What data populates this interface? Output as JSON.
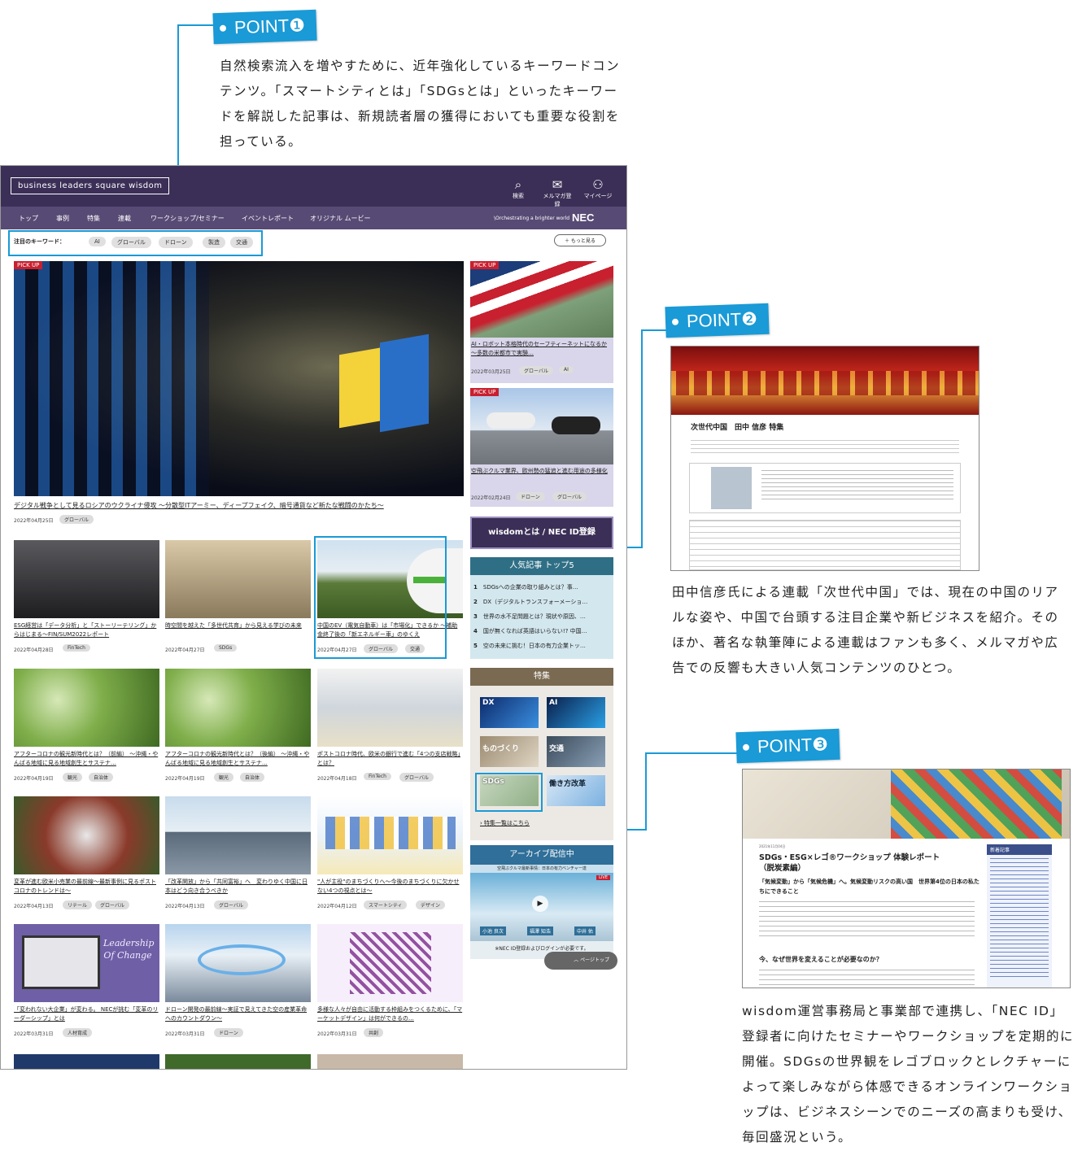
{
  "points": [
    {
      "label": "POINT❶",
      "text": "自然検索流入を増やすために、近年強化しているキーワードコンテンツ。「スマートシティとは」「SDGsとは」といったキーワードを解説した記事は、新規読者層の獲得においても重要な役割を担っている。"
    },
    {
      "label": "POINT❷",
      "text": "田中信彦氏による連載「次世代中国」では、現在の中国のリアルな姿や、中国で台頭する注目企業や新ビジネスを紹介。そのほか、著名な執筆陣による連載はファンも多く、メルマガや広告での反響も大きい人気コンテンツのひとつ。"
    },
    {
      "label": "POINT❸",
      "text": "wisdom運営事務局と事業部で連携し、「NEC ID」登録者に向けたセミナーやワークショップを定期的に開催。SDGsの世界観をレゴブロックとレクチャーによって楽しみながら体感できるオンラインワークショップは、ビジネスシーンでのニーズの高まりも受け、毎回盛況という。"
    }
  ],
  "site": {
    "logo": "business leaders square wisdom",
    "header_icons": [
      {
        "icon": "search-icon",
        "label": "検索"
      },
      {
        "icon": "mail-icon",
        "label": "メルマガ登録"
      },
      {
        "icon": "user-icon",
        "label": "マイページ"
      }
    ],
    "nav": [
      "トップ",
      "事例",
      "特集",
      "連載",
      "ワークショップ/セミナー",
      "イベントレポート",
      "オリジナル ムービー"
    ],
    "tagline": "\\Orchestrating a brighter world",
    "brand": "NEC",
    "keyword_label": "注目のキーワード：",
    "keywords": [
      "AI",
      "グローバル",
      "ドローン",
      "製造",
      "交通"
    ],
    "more": "もっと見る",
    "pickup": "PICK UP",
    "hero": {
      "title": "デジタル戦争として見るロシアのウクライナ侵攻 ～分散型ITアーミー、ディープフェイク、暗号通貨など新たな戦闘のかたち～",
      "date": "2022年04月25日",
      "tags": [
        "グローバル"
      ]
    },
    "side_articles": [
      {
        "title": "AI・ロボット本格時代のセーフティーネットになるか ～多数の米都市で実験…",
        "date": "2022年03月25日",
        "tags": [
          "グローバル",
          "AI"
        ]
      },
      {
        "title": "空飛ぶクルマ業界、欧州勢の猛追と進む用途の多様化",
        "date": "2022年02月24日",
        "tags": [
          "ドローン",
          "グローバル"
        ]
      }
    ],
    "wisdom_button": "wisdomとは / NEC ID登録",
    "ranking": {
      "title": "人気記事 トップ5",
      "items": [
        "SDGsへの企業の取り組みとは？事…",
        "DX（デジタルトランスフォーメーショ…",
        "世界の水不足問題とは？現状や原因、…",
        "国が無くなれば英語はいらない!? 中国…",
        "空の未来に挑む！日本の有力企業トッ…"
      ]
    },
    "feature": {
      "title": "特集",
      "items": [
        "DX",
        "AI",
        "ものづくり",
        "交通",
        "SDGs",
        "働き方改革"
      ],
      "link": "特集一覧はこちら"
    },
    "archive": {
      "title": "アーカイブ配信中",
      "subtitle": "空飛ぶクルマ最新事情：日本の有力ベンチャー達",
      "live": "LIVE",
      "names": [
        "小池 良次",
        "福澤 知浩",
        "中井 佑"
      ],
      "note": "※NEC ID登録およびログインが必要です。"
    },
    "page_top": "ページトップ",
    "articles": [
      {
        "title": "ESG経営は「データ分析」と「ストーリーテリング」からはじまる～FIN/SUM2022レポート",
        "date": "2022年04月28日",
        "tags": [
          "FinTech"
        ]
      },
      {
        "title": "時空間を越えた「多世代共育」から見える学びの未来",
        "date": "2022年04月27日",
        "tags": [
          "SDGs"
        ]
      },
      {
        "title": "中国のEV（電気自動車）は「市場化」できるか ～補助金終了後の「新エネルギー車」のゆくえ",
        "date": "2022年04月27日",
        "tags": [
          "グローバル",
          "交通"
        ]
      },
      {
        "title": "アフターコロナの観光新時代とは？（前編） ～沖縄・やんばる地域に見る地域創生とサステナ…",
        "date": "2022年04月19日",
        "tags": [
          "観光",
          "自治体"
        ]
      },
      {
        "title": "アフターコロナの観光新時代とは？（後編） ～沖縄・やんばる地域に見る地域創生とサステナ…",
        "date": "2022年04月19日",
        "tags": [
          "観光",
          "自治体"
        ]
      },
      {
        "title": "ポストコロナ時代、欧米の銀行で進む「4つの支店戦略」とは？",
        "date": "2022年04月18日",
        "tags": [
          "FinTech",
          "グローバル"
        ]
      },
      {
        "title": "変革が進む欧米小売業の最前線～最新事例に見るポストコロナのトレンドは～",
        "date": "2022年04月13日",
        "tags": [
          "リテール",
          "グローバル"
        ]
      },
      {
        "title": "「改革開放」から「共同富裕」へ　変わりゆく中国に日本はどう向き合うべきか",
        "date": "2022年04月13日",
        "tags": [
          "グローバル"
        ]
      },
      {
        "title": "\"人が主役\"のまちづくりへ～今後のまちづくりに欠かせない4つの視点とは～",
        "date": "2022年04月12日",
        "tags": [
          "スマートシティ",
          "デザイン"
        ]
      },
      {
        "title": "「変われない大企業」が変わる。 NECが挑む「変革のリーダーシップ」とは",
        "date": "2022年03月31日",
        "tags": [
          "人材育成"
        ]
      },
      {
        "title": "ドローン開発の最前線～実証で見えてきた空の産業革命へのカウントダウン～",
        "date": "2022年03月31日",
        "tags": [
          "ドローン"
        ]
      },
      {
        "title": "多様な人々が自由に活動する枠組みをつくるために、「マーケットデザイン」は何ができるの…",
        "date": "2022年03月31日",
        "tags": [
          "共創"
        ]
      }
    ],
    "thumb_text": {
      "leadership": "Leadership Of Change"
    }
  },
  "shot2": {
    "title": "次世代中国　田中 信彦 特集"
  },
  "shot3": {
    "date": "2021年11月04日",
    "title": "SDGs・ESG×レゴ®ワークショップ 体験レポート（脱炭素編）",
    "subtitle": "「気候変動」から「気候危機」へ。気候変動リスクの高い国　世界第4位の日本の私たちにできること",
    "heading": "今、なぜ世界を変えることが必要なのか？",
    "sidebar_title": "新着記事"
  }
}
